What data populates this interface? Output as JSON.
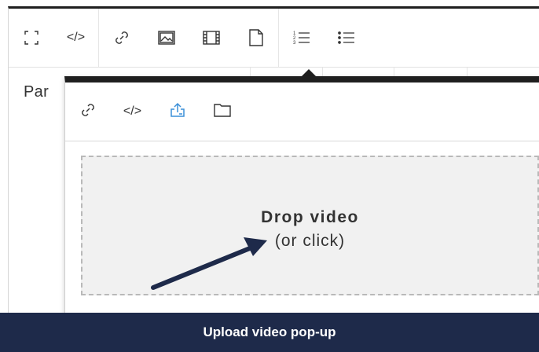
{
  "toolbar": {
    "buttons": [
      {
        "icon": "fullscreen-icon"
      },
      {
        "icon": "code-icon",
        "label": "</>"
      },
      {
        "icon": "link-icon"
      },
      {
        "icon": "image-icon"
      },
      {
        "icon": "video-icon"
      },
      {
        "icon": "file-icon"
      },
      {
        "icon": "ordered-list-icon"
      },
      {
        "icon": "unordered-list-icon"
      }
    ]
  },
  "paragraph": {
    "label": "Par"
  },
  "popup": {
    "tabs": [
      {
        "icon": "link-icon"
      },
      {
        "icon": "code-icon",
        "label": "</>"
      },
      {
        "icon": "upload-icon",
        "active": true
      },
      {
        "icon": "folder-icon"
      }
    ],
    "dropzone": {
      "title": "Drop video",
      "subtitle": "(or click)"
    }
  },
  "caption": {
    "text": "Upload video pop-up"
  },
  "colors": {
    "accent": "#3a8fd8",
    "banner": "#1e2a4a",
    "arrow": "#1e2a4a",
    "dropzone_bg": "#f1f1f1"
  }
}
